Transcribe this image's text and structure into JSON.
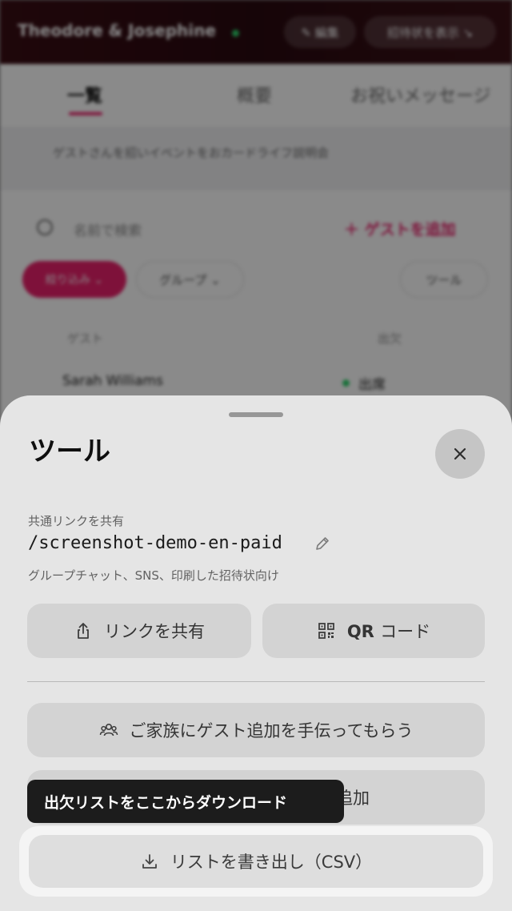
{
  "background": {
    "couple_name": "Theodore & Josephine",
    "header_btn1": "✎ 編集",
    "header_btn2": "招待状を表示 ↘",
    "tabs": [
      "一覧",
      "概要",
      "お祝いメッセージ"
    ],
    "notice": "ゲストさんを招いイベントをおカードライフ説明会",
    "search_placeholder": "名前で検索",
    "add_guest": "＋ ゲストを追加",
    "filter_chip": "絞り込み ⌄",
    "group_chip": "グループ ⌄",
    "tool_chip": "ツール",
    "col_guest": "ゲスト",
    "col_status": "出欠",
    "row_name": "Sarah Williams",
    "row_status": "出席"
  },
  "sheet": {
    "title": "ツール",
    "share_label": "共通リンクを共有",
    "share_path": "/screenshot-demo-en-paid",
    "share_hint": "グループチャット、SNS、印刷した招待状向け",
    "share_link_button": "リンクを共有",
    "qr_button_bold": "QR",
    "qr_button_rest": "コード",
    "family_button": "ご家族にゲスト追加を手伝ってもらう",
    "second_button_tail": "追加",
    "export_button": "リストを書き出し（CSV）",
    "tooltip": "出欠リストをここからダウンロード"
  },
  "colors": {
    "accent": "#e9216b",
    "status_green": "#2fcf6a",
    "tooltip_bg": "#1c1c1c"
  },
  "icons": [
    "close-icon",
    "edit-pencil-icon",
    "share-icon",
    "qr-code-icon",
    "family-icon",
    "download-icon",
    "search-icon"
  ]
}
